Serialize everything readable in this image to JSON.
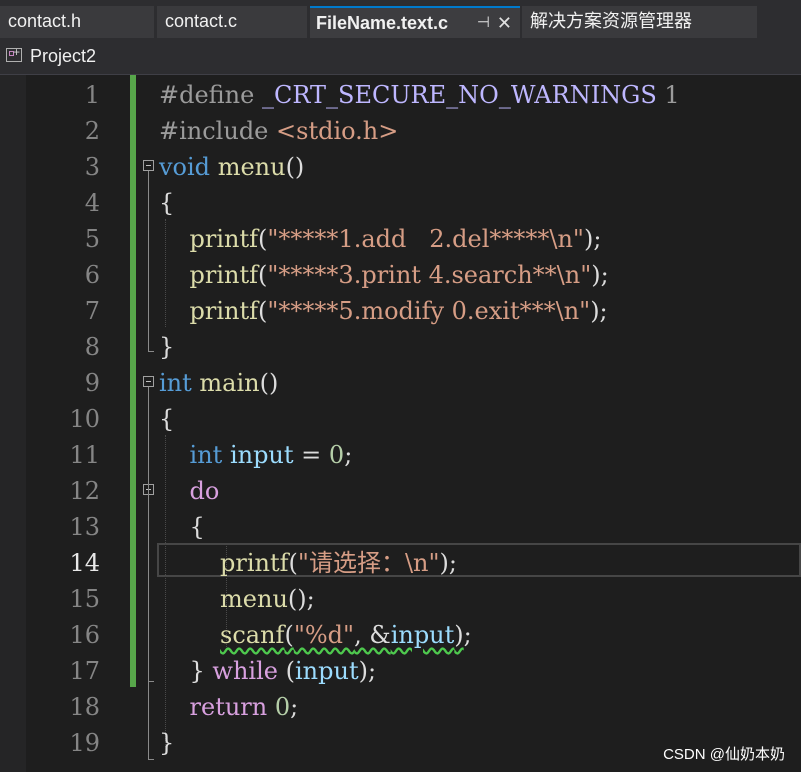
{
  "tabs": [
    {
      "label": "contact.h",
      "active": false
    },
    {
      "label": "contact.c",
      "active": false
    },
    {
      "label": "FileName.text.c",
      "active": true
    },
    {
      "label": "解决方案资源管理器",
      "active": false
    }
  ],
  "tab_icons": {
    "pin": "⊣",
    "close": "✕"
  },
  "navbar": {
    "project": "Project2"
  },
  "editor": {
    "current_line": 14,
    "line_numbers": [
      "1",
      "2",
      "3",
      "4",
      "5",
      "6",
      "7",
      "8",
      "9",
      "10",
      "11",
      "12",
      "13",
      "14",
      "15",
      "16",
      "17",
      "18",
      "19"
    ],
    "lines": [
      [
        {
          "t": "#define ",
          "c": "pp"
        },
        {
          "t": "_CRT_SECURE_NO_WARNINGS",
          "c": "macro"
        },
        {
          "t": " 1",
          "c": "pp"
        }
      ],
      [
        {
          "t": "#include ",
          "c": "pp"
        },
        {
          "t": "<stdio.h>",
          "c": "str"
        }
      ],
      [
        {
          "t": "void",
          "c": "kw"
        },
        {
          "t": " "
        },
        {
          "t": "menu",
          "c": "fn"
        },
        {
          "t": "()"
        }
      ],
      [
        {
          "t": "{"
        }
      ],
      [
        {
          "t": "    "
        },
        {
          "t": "printf",
          "c": "fn"
        },
        {
          "t": "("
        },
        {
          "t": "\"*****1.add   2.del*****\\n\"",
          "c": "str"
        },
        {
          "t": ");"
        }
      ],
      [
        {
          "t": "    "
        },
        {
          "t": "printf",
          "c": "fn"
        },
        {
          "t": "("
        },
        {
          "t": "\"*****3.print 4.search**\\n\"",
          "c": "str"
        },
        {
          "t": ");"
        }
      ],
      [
        {
          "t": "    "
        },
        {
          "t": "printf",
          "c": "fn"
        },
        {
          "t": "("
        },
        {
          "t": "\"*****5.modify 0.exit***\\n\"",
          "c": "str"
        },
        {
          "t": ");"
        }
      ],
      [
        {
          "t": "}"
        }
      ],
      [
        {
          "t": "int",
          "c": "kw"
        },
        {
          "t": " "
        },
        {
          "t": "main",
          "c": "fn"
        },
        {
          "t": "()"
        }
      ],
      [
        {
          "t": "{"
        }
      ],
      [
        {
          "t": "    "
        },
        {
          "t": "int",
          "c": "kw"
        },
        {
          "t": " "
        },
        {
          "t": "input",
          "c": "var"
        },
        {
          "t": " = "
        },
        {
          "t": "0",
          "c": "num"
        },
        {
          "t": ";"
        }
      ],
      [
        {
          "t": "    "
        },
        {
          "t": "do",
          "c": "kw2"
        }
      ],
      [
        {
          "t": "    {"
        }
      ],
      [
        {
          "t": "        "
        },
        {
          "t": "printf",
          "c": "fn"
        },
        {
          "t": "("
        },
        {
          "t": "\"请选择：\\n\"",
          "c": "str"
        },
        {
          "t": ");"
        }
      ],
      [
        {
          "t": "        "
        },
        {
          "t": "menu",
          "c": "fn"
        },
        {
          "t": "();"
        }
      ],
      [
        {
          "t": "        "
        },
        {
          "t": "scanf",
          "c": "fn",
          "u": true
        },
        {
          "t": "(",
          "u": true
        },
        {
          "t": "\"%d\"",
          "c": "str",
          "u": true
        },
        {
          "t": ", &",
          "u": true
        },
        {
          "t": "input",
          "c": "var",
          "u": true
        },
        {
          "t": ")",
          "u": true
        },
        {
          "t": ";"
        }
      ],
      [
        {
          "t": "    } "
        },
        {
          "t": "while",
          "c": "kw2"
        },
        {
          "t": " ("
        },
        {
          "t": "input",
          "c": "var"
        },
        {
          "t": ");"
        }
      ],
      [
        {
          "t": "    "
        },
        {
          "t": "return",
          "c": "kw2"
        },
        {
          "t": " "
        },
        {
          "t": "0",
          "c": "num"
        },
        {
          "t": ";"
        }
      ],
      [
        {
          "t": "}"
        }
      ]
    ],
    "fold_lines": [
      3,
      9,
      12
    ]
  },
  "watermark": "CSDN @仙奶本奶"
}
